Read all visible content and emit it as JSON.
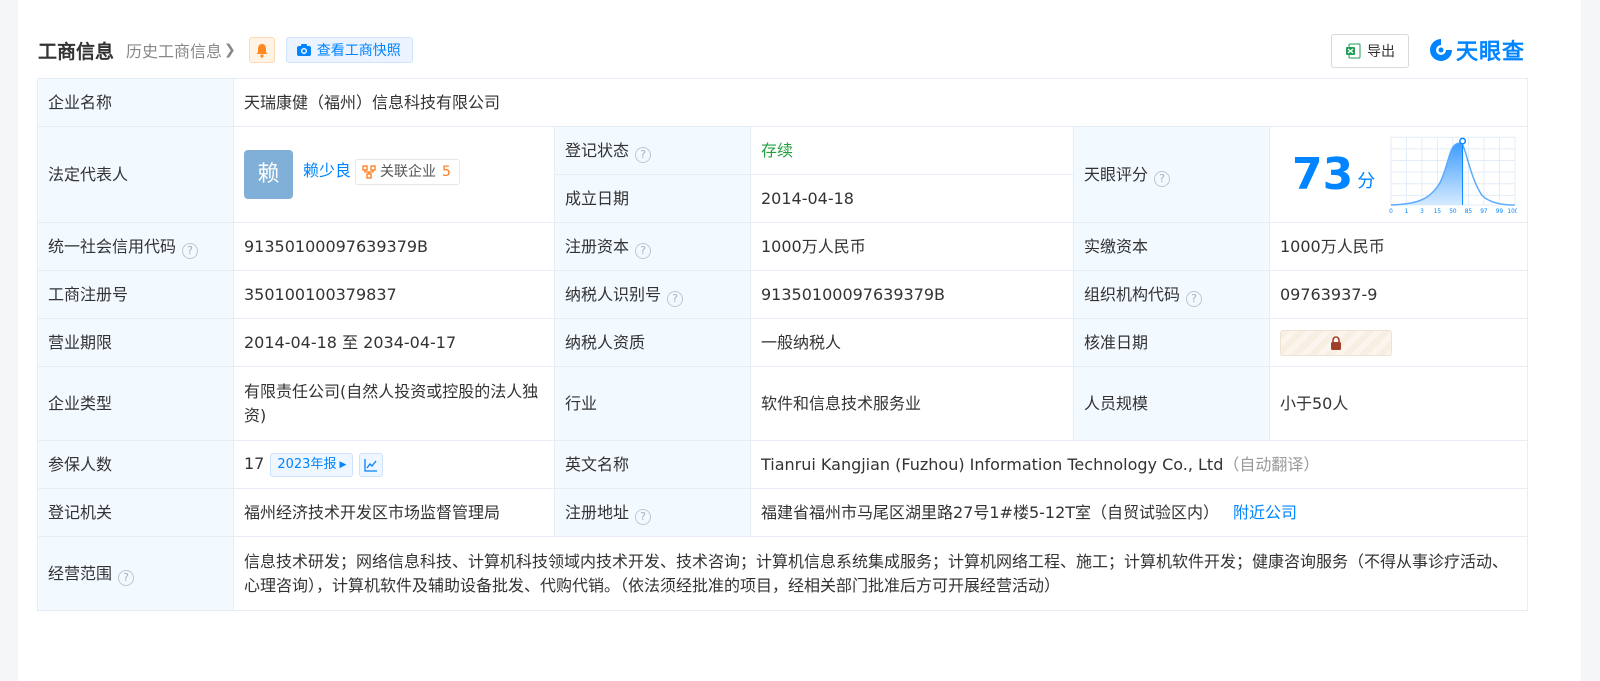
{
  "header": {
    "title": "工商信息",
    "history_label": "历史工商信息",
    "snapshot_label": "查看工商快照",
    "export_label": "导出",
    "logo_text": "天眼查"
  },
  "colors": {
    "accent": "#0084ff",
    "status_green": "#23a041",
    "count_orange": "#ff7a1a",
    "label_bg": "#f2f9ff"
  },
  "company": {
    "name_label": "企业名称",
    "name": "天瑞康健（福州）信息科技有限公司",
    "rep_label": "法定代表人",
    "rep_avatar_char": "赖",
    "rep_name": "赖少良",
    "rel_label": "关联企业",
    "rel_count": "5",
    "status_label": "登记状态",
    "status": "存续",
    "found_label": "成立日期",
    "found_date": "2014-04-18",
    "score_label": "天眼评分",
    "score": "73",
    "score_unit": "分",
    "score_percentile_ticks": [
      "0",
      "1",
      "3",
      "15",
      "50",
      "85",
      "97",
      "99",
      "100"
    ],
    "credit_label": "统一社会信用代码",
    "credit_code": "91350100097639379B",
    "reg_capital_label": "注册资本",
    "reg_capital": "1000万人民币",
    "paid_capital_label": "实缴资本",
    "paid_capital": "1000万人民币",
    "reg_no_label": "工商注册号",
    "reg_no": "350100100379837",
    "tax_id_label": "纳税人识别号",
    "tax_id": "91350100097639379B",
    "org_code_label": "组织机构代码",
    "org_code": "09763937-9",
    "term_label": "营业期限",
    "term": "2014-04-18 至 2034-04-17",
    "tax_qual_label": "纳税人资质",
    "tax_qual": "一般纳税人",
    "approve_label": "核准日期",
    "type_label": "企业类型",
    "type": "有限责任公司(自然人投资或控股的法人独资)",
    "industry_label": "行业",
    "industry": "软件和信息技术服务业",
    "staff_label": "人员规模",
    "staff": "小于50人",
    "insured_label": "参保人数",
    "insured": "17",
    "annual_label": "2023年报",
    "en_name_label": "英文名称",
    "en_name": "Tianrui Kangjian (Fuzhou) Information Technology Co., Ltd",
    "en_name_note": "（自动翻译）",
    "authority_label": "登记机关",
    "authority": "福州经济技术开发区市场监督管理局",
    "address_label": "注册地址",
    "address": "福建省福州市马尾区湖里路27号1#楼5-12T室（自贸试验区内）",
    "nearby_label": "附近公司",
    "scope_label": "经营范围",
    "scope": "信息技术研发；网络信息科技、计算机科技领域内技术开发、技术咨询；计算机信息系统集成服务；计算机网络工程、施工；计算机软件开发；健康咨询服务（不得从事诊疗活动、心理咨询），计算机软件及辅助设备批发、代购代销。（依法须经批准的项目，经相关部门批准后方可开展经营活动）"
  }
}
